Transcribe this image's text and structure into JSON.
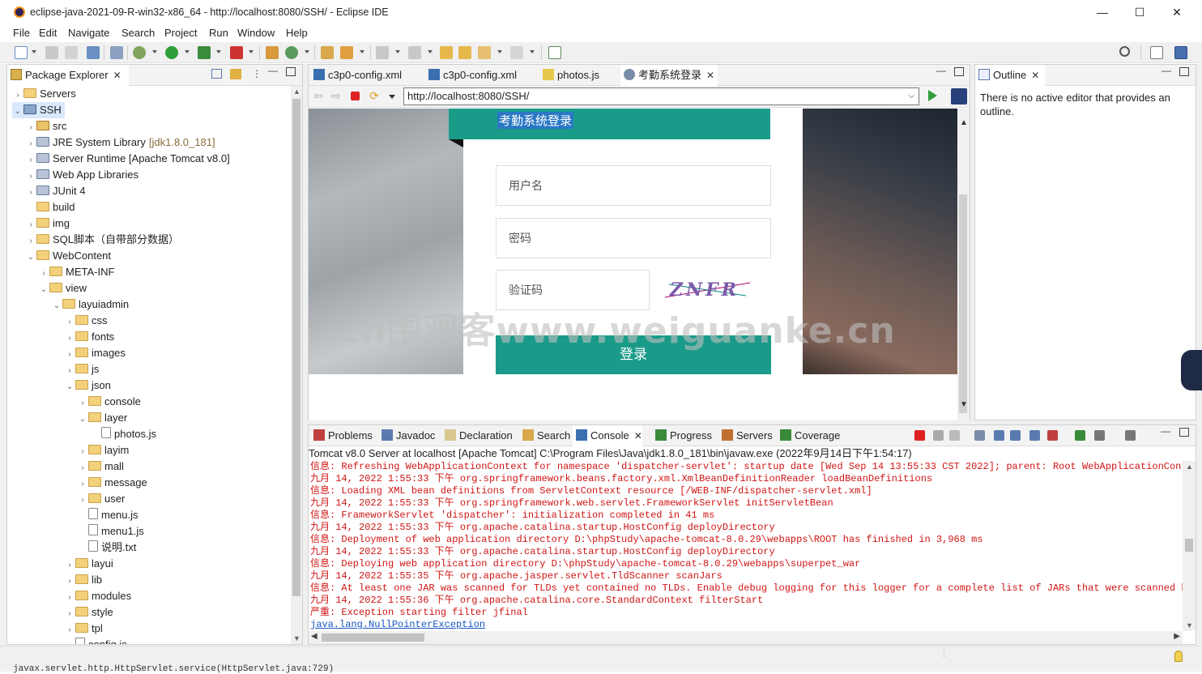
{
  "window": {
    "title": "eclipse-java-2021-09-R-win32-x86_64 - http://localhost:8080/SSH/ - Eclipse IDE",
    "controls": {
      "minimize": "—",
      "maximize": "☐",
      "close": "✕"
    }
  },
  "menu": [
    "File",
    "Edit",
    "Navigate",
    "Search",
    "Project",
    "Run",
    "Window",
    "Help"
  ],
  "package_explorer": {
    "title": "Package Explorer",
    "items": [
      {
        "label": "Servers",
        "level": 0,
        "expanded": false,
        "icon": "folder"
      },
      {
        "label": "SSH",
        "level": 0,
        "expanded": true,
        "icon": "project",
        "selected": true
      },
      {
        "label": "src",
        "level": 1,
        "expanded": false,
        "icon": "package"
      },
      {
        "label": "JRE System Library",
        "suffix": "[jdk1.8.0_181]",
        "level": 1,
        "expanded": false,
        "icon": "library"
      },
      {
        "label": "Server Runtime [Apache Tomcat v8.0]",
        "level": 1,
        "expanded": false,
        "icon": "library"
      },
      {
        "label": "Web App Libraries",
        "level": 1,
        "expanded": false,
        "icon": "library"
      },
      {
        "label": "JUnit 4",
        "level": 1,
        "expanded": false,
        "icon": "library"
      },
      {
        "label": "build",
        "level": 1,
        "expanded": null,
        "icon": "folder"
      },
      {
        "label": "img",
        "level": 1,
        "expanded": false,
        "icon": "folder"
      },
      {
        "label": "SQL脚本（自带部分数据）",
        "level": 1,
        "expanded": false,
        "icon": "folder"
      },
      {
        "label": "WebContent",
        "level": 1,
        "expanded": true,
        "icon": "folder"
      },
      {
        "label": "META-INF",
        "level": 2,
        "expanded": false,
        "icon": "folder"
      },
      {
        "label": "view",
        "level": 2,
        "expanded": true,
        "icon": "folder"
      },
      {
        "label": "layuiadmin",
        "level": 3,
        "expanded": true,
        "icon": "folder"
      },
      {
        "label": "css",
        "level": 4,
        "expanded": false,
        "icon": "folder"
      },
      {
        "label": "fonts",
        "level": 4,
        "expanded": false,
        "icon": "folder"
      },
      {
        "label": "images",
        "level": 4,
        "expanded": false,
        "icon": "folder"
      },
      {
        "label": "js",
        "level": 4,
        "expanded": false,
        "icon": "folder"
      },
      {
        "label": "json",
        "level": 4,
        "expanded": true,
        "icon": "folder"
      },
      {
        "label": "console",
        "level": 5,
        "expanded": false,
        "icon": "folder"
      },
      {
        "label": "layer",
        "level": 5,
        "expanded": true,
        "icon": "folder"
      },
      {
        "label": "photos.js",
        "level": 6,
        "expanded": null,
        "icon": "js"
      },
      {
        "label": "layim",
        "level": 5,
        "expanded": false,
        "icon": "folder"
      },
      {
        "label": "mall",
        "level": 5,
        "expanded": false,
        "icon": "folder"
      },
      {
        "label": "message",
        "level": 5,
        "expanded": false,
        "icon": "folder"
      },
      {
        "label": "user",
        "level": 5,
        "expanded": false,
        "icon": "folder"
      },
      {
        "label": "menu.js",
        "level": 5,
        "expanded": null,
        "icon": "js"
      },
      {
        "label": "menu1.js",
        "level": 5,
        "expanded": null,
        "icon": "js"
      },
      {
        "label": "说明.txt",
        "level": 5,
        "expanded": null,
        "icon": "txt"
      },
      {
        "label": "layui",
        "level": 4,
        "expanded": false,
        "icon": "folder"
      },
      {
        "label": "lib",
        "level": 4,
        "expanded": false,
        "icon": "folder"
      },
      {
        "label": "modules",
        "level": 4,
        "expanded": false,
        "icon": "folder"
      },
      {
        "label": "style",
        "level": 4,
        "expanded": false,
        "icon": "folder"
      },
      {
        "label": "tpl",
        "level": 4,
        "expanded": false,
        "icon": "folder"
      },
      {
        "label": "config.js",
        "level": 4,
        "expanded": null,
        "icon": "js"
      }
    ]
  },
  "editor_tabs": [
    {
      "label": "c3p0-config.xml",
      "active": false
    },
    {
      "label": "c3p0-config.xml",
      "active": false
    },
    {
      "label": "photos.js",
      "active": false
    },
    {
      "label": "考勤系统登录",
      "active": true
    }
  ],
  "browser": {
    "url": "http://localhost:8080/SSH/",
    "page": {
      "header": "考勤系统登录",
      "username_placeholder": "用户名",
      "password_placeholder": "密码",
      "captcha_placeholder": "验证码",
      "captcha_text": "ZNFR",
      "login_button": "登录"
    },
    "watermark": "cn围观客www.weiguanke.cn"
  },
  "outline": {
    "title": "Outline",
    "message": "There is no active editor that provides an outline."
  },
  "console_tabs": [
    {
      "label": "Problems"
    },
    {
      "label": "Javadoc"
    },
    {
      "label": "Declaration"
    },
    {
      "label": "Search"
    },
    {
      "label": "Console",
      "active": true
    },
    {
      "label": "Progress"
    },
    {
      "label": "Servers"
    },
    {
      "label": "Coverage"
    }
  ],
  "console": {
    "header": "Tomcat v8.0 Server at localhost [Apache Tomcat] C:\\Program Files\\Java\\jdk1.8.0_181\\bin\\javaw.exe  (2022年9月14日下午1:54:17)",
    "lines": [
      {
        "text": "信息: Refreshing WebApplicationContext for namespace 'dispatcher-servlet': startup date [Wed Sep 14 13:55:33 CST 2022]; parent: Root WebApplicationContext",
        "type": "error"
      },
      {
        "text": "九月 14, 2022 1:55:33 下午 org.springframework.beans.factory.xml.XmlBeanDefinitionReader loadBeanDefinitions",
        "type": "error"
      },
      {
        "text": "信息: Loading XML bean definitions from ServletContext resource [/WEB-INF/dispatcher-servlet.xml]",
        "type": "error"
      },
      {
        "text": "九月 14, 2022 1:55:33 下午 org.springframework.web.servlet.FrameworkServlet initServletBean",
        "type": "error"
      },
      {
        "text": "信息: FrameworkServlet 'dispatcher': initialization completed in 41 ms",
        "type": "error"
      },
      {
        "text": "九月 14, 2022 1:55:33 下午 org.apache.catalina.startup.HostConfig deployDirectory",
        "type": "error"
      },
      {
        "text": "信息: Deployment of web application directory D:\\phpStudy\\apache-tomcat-8.0.29\\webapps\\ROOT has finished in 3,968 ms",
        "type": "error"
      },
      {
        "text": "九月 14, 2022 1:55:33 下午 org.apache.catalina.startup.HostConfig deployDirectory",
        "type": "error"
      },
      {
        "text": "信息: Deploying web application directory D:\\phpStudy\\apache-tomcat-8.0.29\\webapps\\superpet_war",
        "type": "error"
      },
      {
        "text": "九月 14, 2022 1:55:35 下午 org.apache.jasper.servlet.TldScanner scanJars",
        "type": "error"
      },
      {
        "text": "信息: At least one JAR was scanned for TLDs yet contained no TLDs. Enable debug logging for this logger for a complete list of JARs that were scanned but no",
        "type": "error"
      },
      {
        "text": "九月 14, 2022 1:55:36 下午 org.apache.catalina.core.StandardContext filterStart",
        "type": "error"
      },
      {
        "text": "严重: Exception starting filter jfinal",
        "type": "error"
      },
      {
        "text": "java.lang.NullPointerException",
        "type": "link"
      }
    ]
  },
  "bottom_text": "javax.servlet.http.HttpServlet.service(HttpServlet.java:729)"
}
